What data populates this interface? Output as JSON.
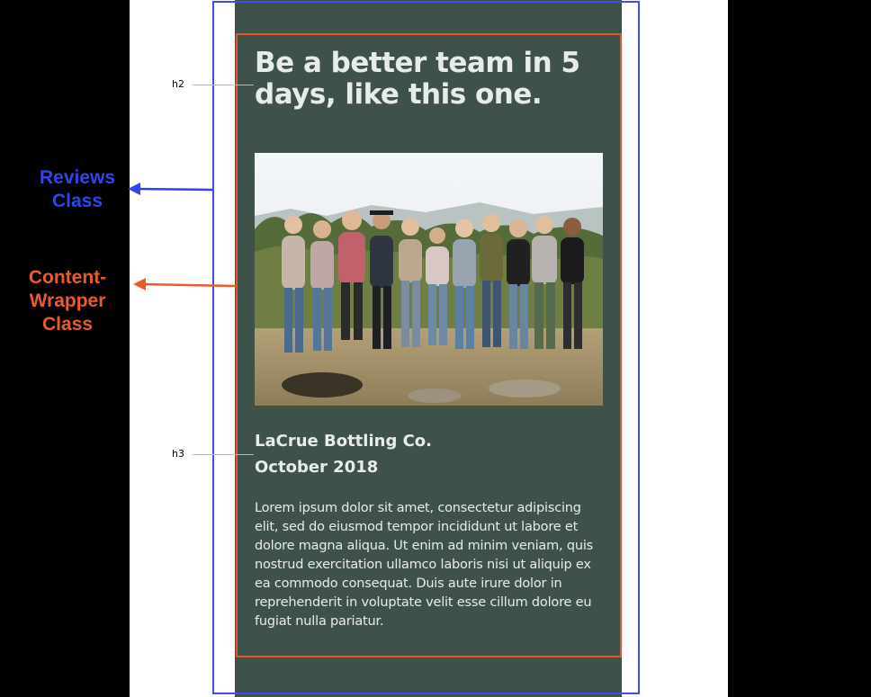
{
  "panel": {
    "headline": "Be a better team in 5 days, like this one.",
    "company": "LaCrue Bottling Co.",
    "date": "October 2018",
    "body": "Lorem ipsum dolor sit amet, consectetur adipiscing elit, sed do eiusmod tempor incididunt ut labore et dolore magna aliqua. Ut enim ad minim veniam, quis nostrud exercitation ullamco laboris nisi ut aliquip ex ea commodo consequat. Duis aute irure dolor in reprehenderit in voluptate velit esse cillum dolore eu fugiat nulla pariatur.",
    "photo_icon": "group-photo-icon"
  },
  "annotations": {
    "h2_tag": "h2",
    "h3_tag": "h3",
    "reviews_class": [
      "Reviews",
      "Class"
    ],
    "content_wrapper_class": [
      "Content-",
      "Wrapper",
      "Class"
    ]
  },
  "colors": {
    "background": "#000000",
    "page": "#ffffff",
    "panel": "#3f524a",
    "panel_text": "#e8ece9",
    "reviews_outline": "#3b4fe0",
    "content_wrapper_outline": "#e0532f",
    "reviews_label": "#2f45f0",
    "content_wrapper_label": "#ef5a2c"
  }
}
